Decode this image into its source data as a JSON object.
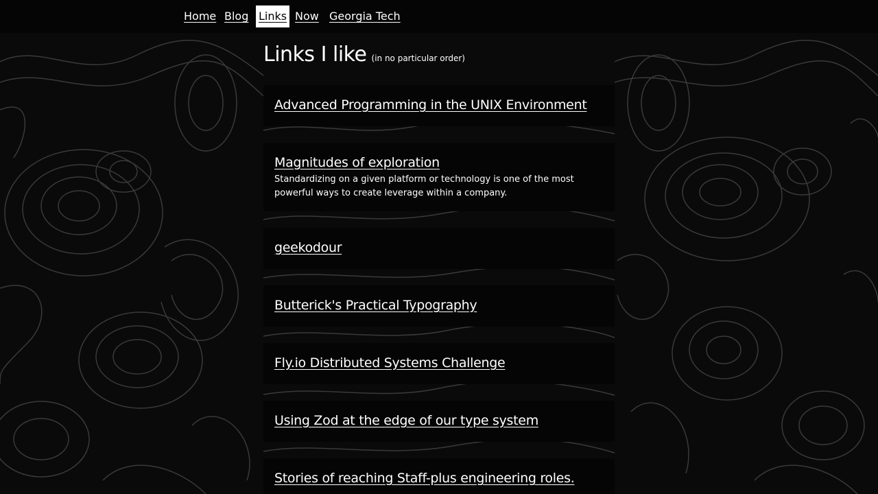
{
  "nav": {
    "items": [
      {
        "label": "Home",
        "active": false
      },
      {
        "label": "Blog",
        "active": false
      },
      {
        "label": "Links",
        "active": true
      },
      {
        "label": "Now",
        "active": false
      },
      {
        "label": "Georgia Tech",
        "active": false
      }
    ]
  },
  "page": {
    "title": "Links I like",
    "subtitle": "(in no particular order)"
  },
  "links": [
    {
      "title": "Advanced Programming in the UNIX Environment",
      "description": ""
    },
    {
      "title": "Magnitudes of exploration",
      "description": "Standardizing on a given platform or technology is one of the most powerful ways to create leverage within a company."
    },
    {
      "title": "geekodour",
      "description": ""
    },
    {
      "title": "Butterick's Practical Typography",
      "description": ""
    },
    {
      "title": "Fly.io Distributed Systems Challenge",
      "description": ""
    },
    {
      "title": "Using Zod at the edge of our type system",
      "description": ""
    },
    {
      "title": "Stories of reaching Staff-plus engineering roles.",
      "description": ""
    }
  ],
  "colors": {
    "background": "#0a0a0a",
    "card": "#050505",
    "text": "#ffffff",
    "topo_lines": "#3a3a3a",
    "active_nav_bg": "#ffffff"
  }
}
